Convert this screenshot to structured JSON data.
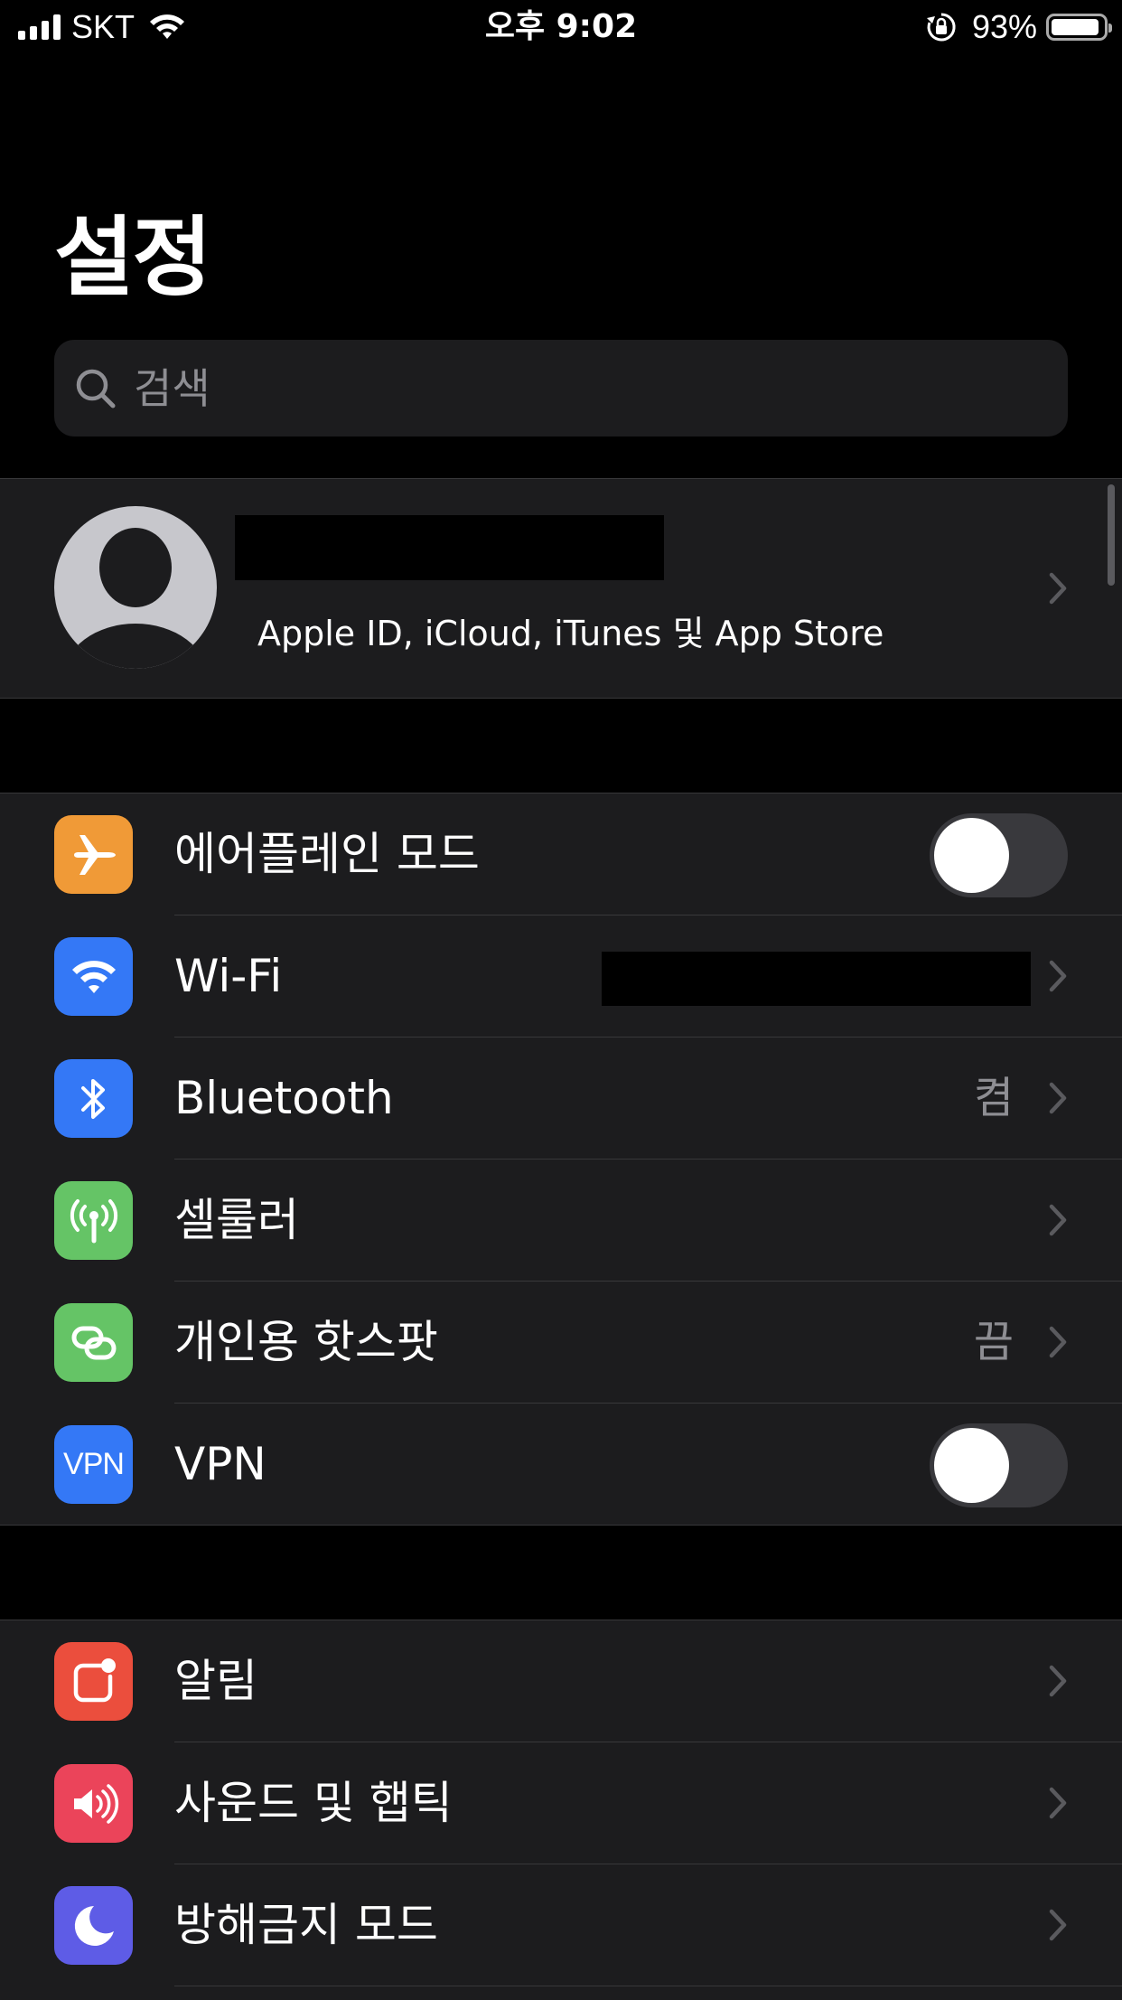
{
  "status_bar": {
    "carrier": "SKT",
    "time": "오후 9:02",
    "battery_percent": "93%",
    "battery_level": 0.93
  },
  "header": {
    "title": "설정"
  },
  "search": {
    "placeholder": "검색"
  },
  "profile": {
    "subtitle": "Apple ID, iCloud, iTunes 및 App Store"
  },
  "connectivity": [
    {
      "label": "에어플레인 모드",
      "icon": "airplane-icon",
      "color": "#f09a37",
      "toggle_on": false
    },
    {
      "label": "Wi-Fi",
      "icon": "wifi-icon",
      "color": "#3478f6"
    },
    {
      "label": "Bluetooth",
      "icon": "bluetooth-icon",
      "color": "#3478f6",
      "value": "켬"
    },
    {
      "label": "셀룰러",
      "icon": "antenna-icon",
      "color": "#65c466"
    },
    {
      "label": "개인용 핫스팟",
      "icon": "hotspot-icon",
      "color": "#65c466",
      "value": "끔"
    },
    {
      "label": "VPN",
      "icon": "vpn-icon",
      "icon_text": "VPN",
      "color": "#3478f6",
      "toggle_on": false
    }
  ],
  "notifications_group": [
    {
      "label": "알림",
      "icon": "notifications-icon",
      "color": "#eb4e3d"
    },
    {
      "label": "사운드 및 햅틱",
      "icon": "speaker-icon",
      "color": "#eb445a"
    },
    {
      "label": "방해금지 모드",
      "icon": "moon-icon",
      "color": "#5e5ce6"
    }
  ]
}
